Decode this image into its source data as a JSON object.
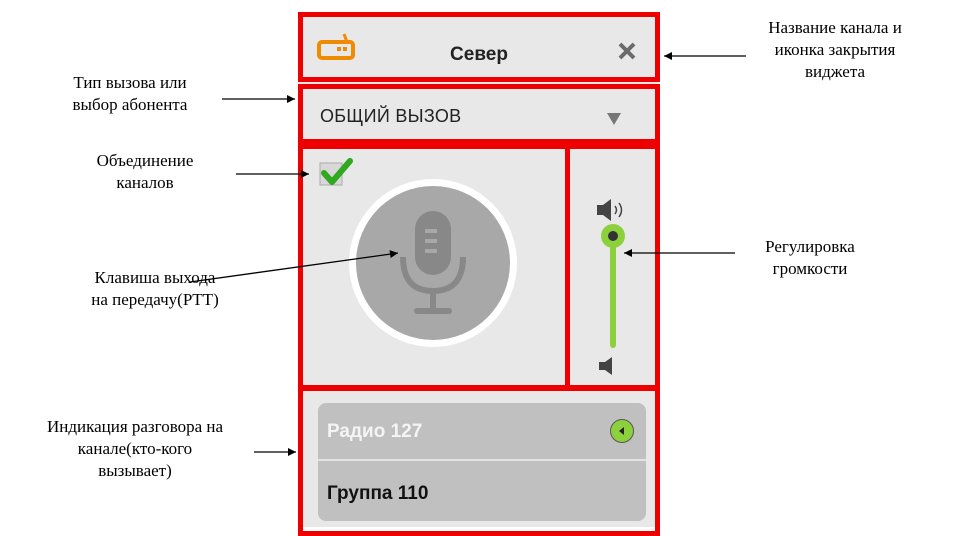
{
  "widget": {
    "channel_title": "Север",
    "call_type": "ОБЩИЙ ВЫЗОВ",
    "caller": "Радио 127",
    "callee": "Группа 110",
    "merge_checked": true,
    "volume_level": 1.0
  },
  "annotations": {
    "call_type": "Тип вызова или\nвыбор абонента",
    "merge": "Объединение\nканалов",
    "ptt": "Клавиша выхода\nна передачу(PTT)",
    "talk": "Индикация разговора на\nканале(кто-кого\nвызывает)",
    "title": "Название канала и\nиконка закрытия\nвиджета",
    "volume": "Регулировка\nгромкости"
  },
  "colors": {
    "frame": "#ee0000",
    "panel": "#e8e8e8",
    "accent_green": "#8cd13d",
    "radio_icon": "#f08a00",
    "ptt_button": "#a8a8a8"
  },
  "icons": [
    "radio-icon",
    "close-icon",
    "dropdown-arrow-icon",
    "checkmark-icon",
    "microphone-icon",
    "volume-high-icon",
    "volume-low-icon",
    "speaker-indicator-icon"
  ]
}
